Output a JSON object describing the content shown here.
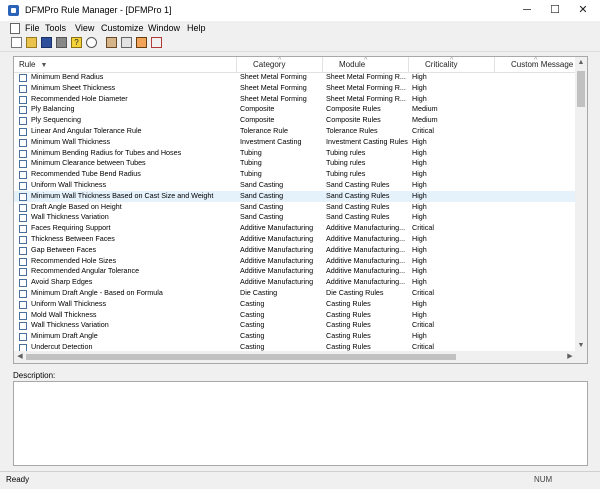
{
  "window": {
    "title": "DFMPro Rule Manager - [DFMPro 1]",
    "minimize_glyph": "─",
    "maximize_glyph": "☐",
    "close_glyph": "✕"
  },
  "menu": [
    "File",
    "Tools",
    "View",
    "Customize",
    "Window",
    "Help"
  ],
  "toolbar_icons": [
    "new-icon",
    "open-icon",
    "save-icon",
    "disabled-icon",
    "help-icon",
    "find-icon",
    "rule-image-icon",
    "rule-list-icon",
    "rule-photo-icon",
    "rule-export-icon"
  ],
  "table": {
    "columns": [
      "Rule",
      "Category",
      "Module",
      "Criticality",
      "Custom Message"
    ],
    "sort_glyph": "▼",
    "chevron_glyph": "^",
    "rows": [
      [
        "Minimum Bend Radius",
        "Sheet Metal Forming",
        "Sheet Metal Forming R...",
        "High"
      ],
      [
        "Minimum Sheet Thickness",
        "Sheet Metal Forming",
        "Sheet Metal Forming R...",
        "High"
      ],
      [
        "Recommended Hole Diameter",
        "Sheet Metal Forming",
        "Sheet Metal Forming R...",
        "High"
      ],
      [
        "Ply Balancing",
        "Composite",
        "Composite Rules",
        "Medium"
      ],
      [
        "Ply Sequencing",
        "Composite",
        "Composite Rules",
        "Medium"
      ],
      [
        "Linear And Angular Tolerance Rule",
        "Tolerance Rule",
        "Tolerance Rules",
        "Critical"
      ],
      [
        "Minimum Wall Thickness",
        "Investment Casting",
        "Investment Casting Rules",
        "High"
      ],
      [
        "Minimum Bending Radius for Tubes and Hoses",
        "Tubing",
        "Tubing rules",
        "High"
      ],
      [
        "Minimum Clearance between Tubes",
        "Tubing",
        "Tubing rules",
        "High"
      ],
      [
        "Recommended Tube Bend Radius",
        "Tubing",
        "Tubing rules",
        "High"
      ],
      [
        "Uniform Wall Thickness",
        "Sand Casting",
        "Sand Casting Rules",
        "High"
      ],
      [
        "Minimum Wall Thickness Based on Cast Size and Weight",
        "Sand Casting",
        "Sand Casting Rules",
        "High"
      ],
      [
        "Draft Angle Based on Height",
        "Sand Casting",
        "Sand Casting Rules",
        "High"
      ],
      [
        "Wall Thickness Variation",
        "Sand Casting",
        "Sand Casting Rules",
        "High"
      ],
      [
        "Faces Requiring Support",
        "Additive Manufacturing",
        "Additive Manufacturing...",
        "Critical"
      ],
      [
        "Thickness Between Faces",
        "Additive Manufacturing",
        "Additive Manufacturing...",
        "High"
      ],
      [
        "Gap Between Faces",
        "Additive Manufacturing",
        "Additive Manufacturing...",
        "High"
      ],
      [
        "Recommended Hole Sizes",
        "Additive Manufacturing",
        "Additive Manufacturing...",
        "High"
      ],
      [
        "Recommended Angular Tolerance",
        "Additive Manufacturing",
        "Additive Manufacturing...",
        "High"
      ],
      [
        "Avoid Sharp Edges",
        "Additive Manufacturing",
        "Additive Manufacturing...",
        "High"
      ],
      [
        "Minimum Draft Angle - Based on Formula",
        "Die Casting",
        "Die Casting Rules",
        "Critical"
      ],
      [
        "Uniform Wall Thickness",
        "Casting",
        "Casting Rules",
        "High"
      ],
      [
        "Mold Wall Thickness",
        "Casting",
        "Casting Rules",
        "High"
      ],
      [
        "Wall Thickness Variation",
        "Casting",
        "Casting Rules",
        "Critical"
      ],
      [
        "Minimum Draft Angle",
        "Casting",
        "Casting Rules",
        "High"
      ],
      [
        "Undercut Detection",
        "Casting",
        "Casting Rules",
        "Critical"
      ]
    ],
    "selected_index": 11
  },
  "scroll_glyphs": {
    "up": "▲",
    "down": "▼",
    "left": "◀",
    "right": "▶"
  },
  "description": {
    "label": "Description:"
  },
  "status": {
    "ready": "Ready",
    "num": "NUM"
  }
}
